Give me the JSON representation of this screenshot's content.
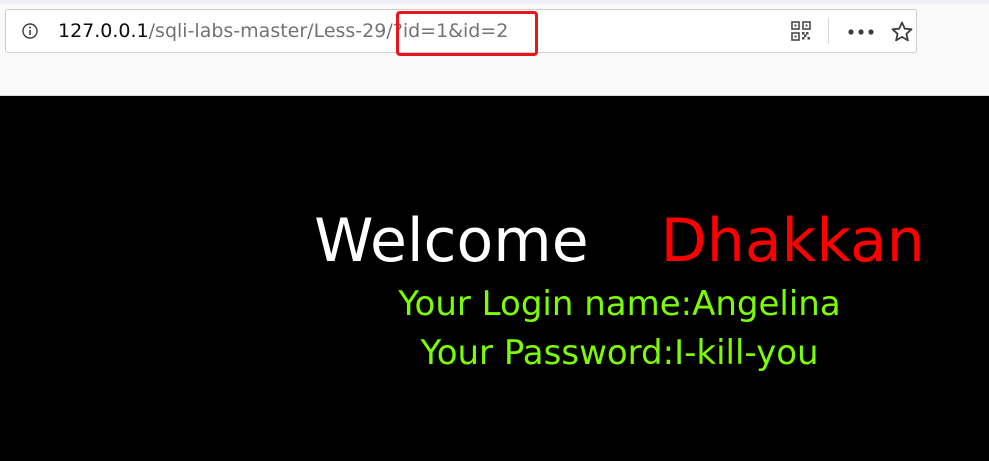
{
  "browser": {
    "url": {
      "host": "127.0.0.1",
      "path": "/sqli-labs-master/Less-29/",
      "query": "?id=1&id=2"
    },
    "icons": {
      "info": "info-icon",
      "qr": "qr-code-icon",
      "more": "more-icon",
      "bookmark": "star-icon"
    },
    "highlight_color": "#e8151b"
  },
  "page": {
    "background": "#000000",
    "welcome": "Welcome",
    "username": "Dhakkan",
    "login_name_line": "Your Login name:Angelina",
    "password_line": "Your Password:I-kill-you",
    "colors": {
      "welcome": "#ffffff",
      "username": "#ff0000",
      "info": "#7cfc00"
    }
  }
}
